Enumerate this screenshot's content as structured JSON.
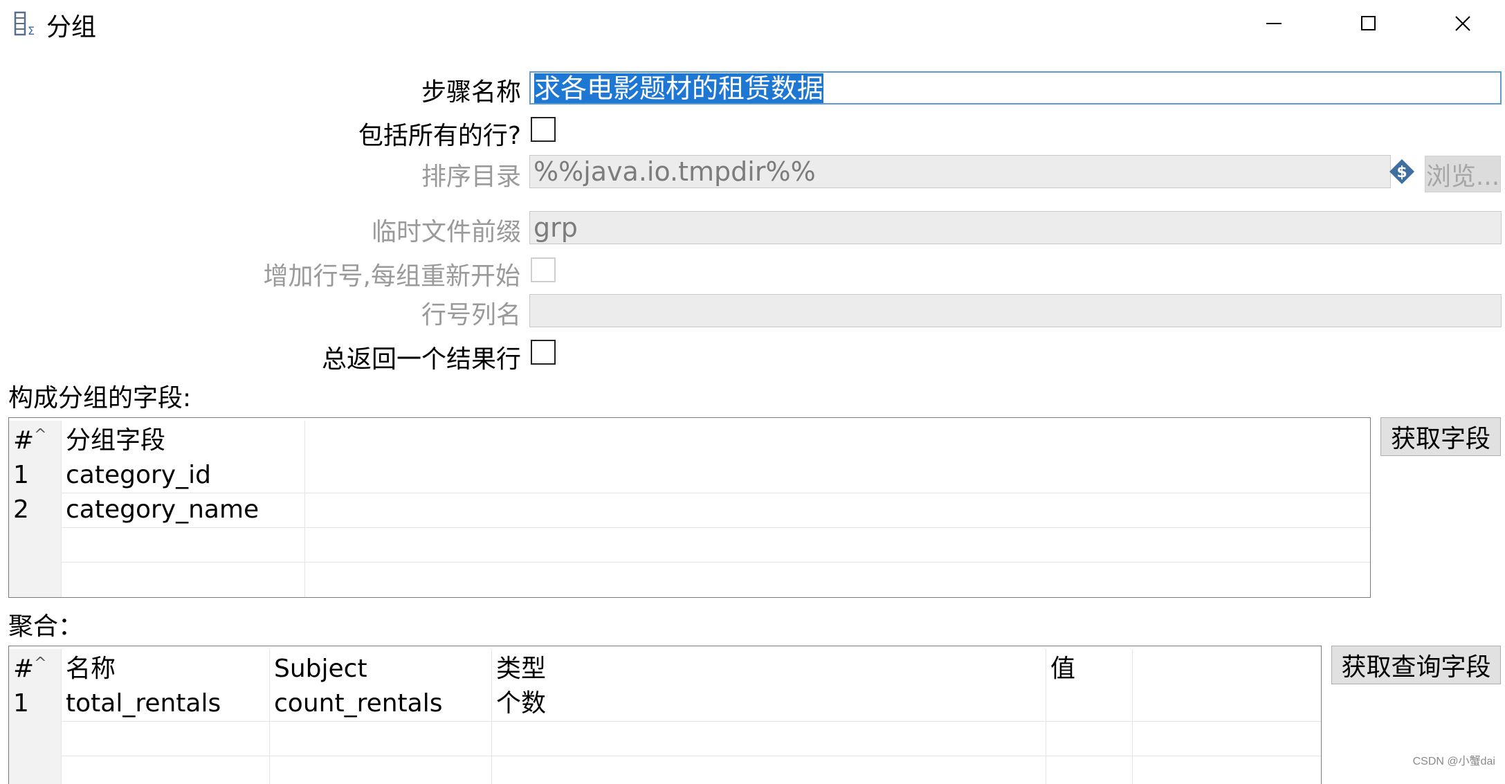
{
  "window": {
    "title": "分组",
    "icon": "group-by-icon"
  },
  "form": {
    "step_name_label": "步骤名称",
    "step_name_value": "求各电影题材的租赁数据",
    "include_all_rows_label": "包括所有的行?",
    "include_all_rows_checked": false,
    "sort_dir_label": "排序目录",
    "sort_dir_value": "%%java.io.tmpdir%%",
    "variable_icon": "dollar-diamond-icon",
    "browse_label": "浏览...",
    "tmp_prefix_label": "临时文件前缀",
    "tmp_prefix_value": "grp",
    "add_line_nr_label": "增加行号,每组重新开始",
    "add_line_nr_checked": false,
    "line_nr_field_label": "行号列名",
    "line_nr_field_value": "",
    "always_one_row_label": "总返回一个结果行",
    "always_one_row_checked": false
  },
  "group_section": {
    "title": "构成分组的字段:",
    "get_fields_label": "获取字段",
    "columns": {
      "idx": "#",
      "field": "分组字段"
    },
    "rows": [
      {
        "idx": "1",
        "field": "category_id"
      },
      {
        "idx": "2",
        "field": "category_name"
      }
    ]
  },
  "agg_section": {
    "title": "聚合：",
    "get_lookup_fields_label": "获取查询字段",
    "columns": {
      "idx": "#",
      "name": "名称",
      "subject": "Subject",
      "type": "类型",
      "value": "值"
    },
    "rows": [
      {
        "idx": "1",
        "name": "total_rentals",
        "subject": "count_rentals",
        "type": "个数",
        "value": ""
      }
    ]
  },
  "watermark": "CSDN @小蟹dai"
}
